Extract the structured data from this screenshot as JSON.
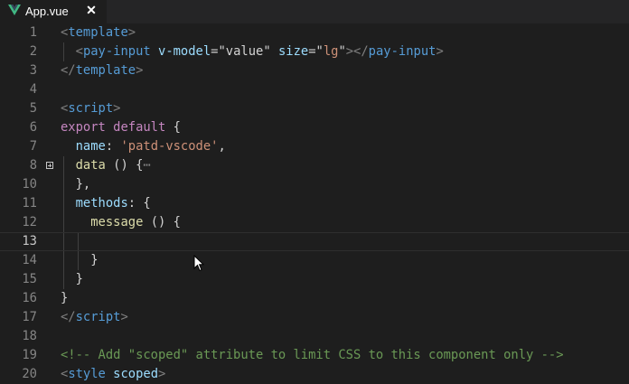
{
  "tab": {
    "label": "App.vue",
    "close": "✕",
    "icon": "vue-logo-icon",
    "accent": "#41b883"
  },
  "lines": [
    {
      "n": "1",
      "segs": [
        [
          "<",
          "t-gray"
        ],
        [
          "template",
          "t-tag"
        ],
        [
          ">",
          "t-gray"
        ]
      ]
    },
    {
      "n": "2",
      "segs": [
        [
          "  ",
          ""
        ],
        [
          "<",
          "t-gray"
        ],
        [
          "pay-input",
          "t-tag"
        ],
        [
          " ",
          "t-plain"
        ],
        [
          "v-model",
          "t-attr"
        ],
        [
          "=",
          "t-plain"
        ],
        [
          "\"value\"",
          "t-plain"
        ],
        [
          " ",
          "t-plain"
        ],
        [
          "size",
          "t-attr"
        ],
        [
          "=",
          "t-plain"
        ],
        [
          "\"",
          "t-plain"
        ],
        [
          "lg",
          "t-str"
        ],
        [
          "\"",
          "t-plain"
        ],
        [
          "></",
          "t-gray"
        ],
        [
          "pay-input",
          "t-tag"
        ],
        [
          ">",
          "t-gray"
        ]
      ]
    },
    {
      "n": "3",
      "segs": [
        [
          "</",
          "t-gray"
        ],
        [
          "template",
          "t-tag"
        ],
        [
          ">",
          "t-gray"
        ]
      ]
    },
    {
      "n": "4",
      "segs": []
    },
    {
      "n": "5",
      "segs": [
        [
          "<",
          "t-gray"
        ],
        [
          "script",
          "t-tag"
        ],
        [
          ">",
          "t-gray"
        ]
      ]
    },
    {
      "n": "6",
      "segs": [
        [
          "export default",
          "t-kw"
        ],
        [
          " {",
          "t-plain"
        ]
      ]
    },
    {
      "n": "7",
      "segs": [
        [
          "  ",
          ""
        ],
        [
          "name",
          "t-prop"
        ],
        [
          ": ",
          "t-plain"
        ],
        [
          "'patd-vscode'",
          "t-str"
        ],
        [
          ",",
          "t-plain"
        ]
      ]
    },
    {
      "n": "8",
      "segs": [
        [
          "  ",
          ""
        ],
        [
          "data",
          "t-fn"
        ],
        [
          " () {",
          "t-plain"
        ],
        [
          "⋯",
          "ellipsis"
        ]
      ]
    },
    {
      "n": "10",
      "segs": [
        [
          "  },",
          "t-plain"
        ]
      ]
    },
    {
      "n": "11",
      "segs": [
        [
          "  ",
          ""
        ],
        [
          "methods",
          "t-prop"
        ],
        [
          ": {",
          "t-plain"
        ]
      ]
    },
    {
      "n": "12",
      "segs": [
        [
          "    ",
          ""
        ],
        [
          "message",
          "t-fn"
        ],
        [
          " () {",
          "t-plain"
        ]
      ]
    },
    {
      "n": "13",
      "segs": []
    },
    {
      "n": "14",
      "segs": [
        [
          "    }",
          "t-plain"
        ]
      ]
    },
    {
      "n": "15",
      "segs": [
        [
          "  }",
          "t-plain"
        ]
      ]
    },
    {
      "n": "16",
      "segs": [
        [
          "}",
          "t-plain"
        ]
      ]
    },
    {
      "n": "17",
      "segs": [
        [
          "</",
          "t-gray"
        ],
        [
          "script",
          "t-tag"
        ],
        [
          ">",
          "t-gray"
        ]
      ]
    },
    {
      "n": "18",
      "segs": []
    },
    {
      "n": "19",
      "segs": [
        [
          "<!-- Add \"scoped\" attribute to limit CSS to this component only -->",
          "t-comment"
        ]
      ]
    },
    {
      "n": "20",
      "segs": [
        [
          "<",
          "t-gray"
        ],
        [
          "style",
          "t-tag"
        ],
        [
          " ",
          "t-plain"
        ],
        [
          "scoped",
          "t-attr"
        ],
        [
          ">",
          "t-gray"
        ]
      ]
    }
  ],
  "current_line": "13",
  "folded_line": "8",
  "pointer_icon": "mouse-pointer-icon"
}
